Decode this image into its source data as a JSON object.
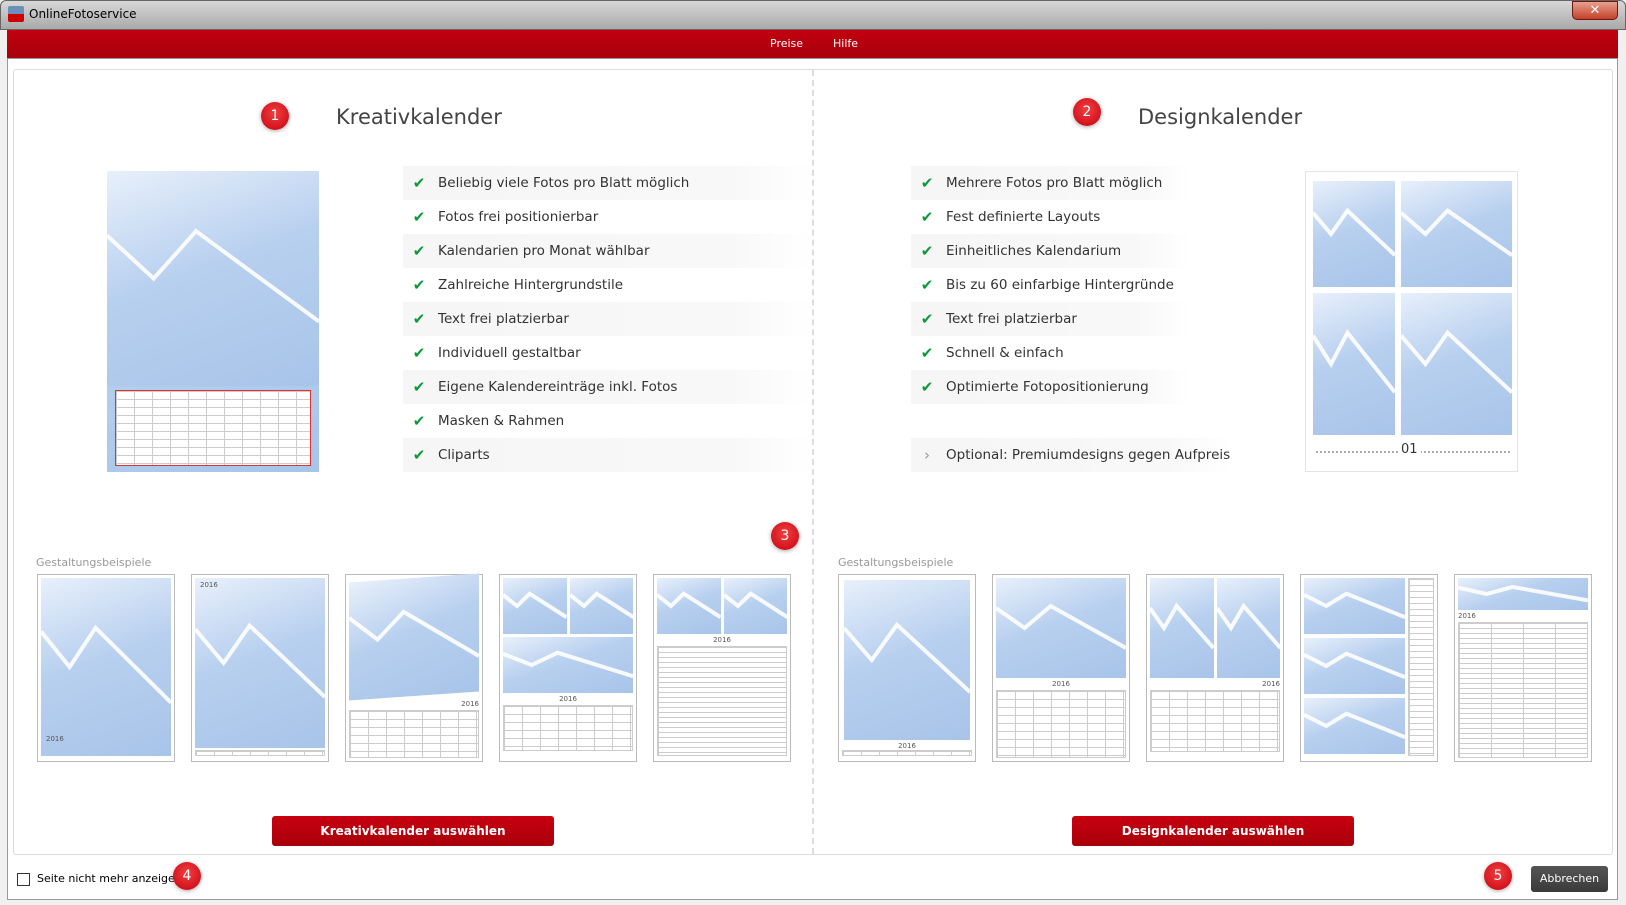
{
  "window": {
    "title": "OnlineFotoservice",
    "close": "✕"
  },
  "menu": [
    {
      "label": "Preise"
    },
    {
      "label": "Hilfe"
    }
  ],
  "badges": [
    "1",
    "2",
    "3",
    "4",
    "5"
  ],
  "kreativ": {
    "title": "Kreativkalender",
    "features": [
      "Beliebig viele Fotos pro Blatt möglich",
      "Fotos frei positionierbar",
      "Kalendarien pro Monat wählbar",
      "Zahlreiche Hintergrundstile",
      "Text frei platzierbar",
      "Individuell gestaltbar",
      "Eigene Kalendereinträge inkl. Fotos",
      "Masken & Rahmen",
      "Cliparts"
    ],
    "examples_label": "Gestaltungsbeispiele",
    "select_button": "Kreativkalender auswählen"
  },
  "design": {
    "title": "Designkalender",
    "features": [
      "Mehrere Fotos pro Blatt möglich",
      "Fest definierte Layouts",
      "Einheitliches Kalendarium",
      "Bis zu 60 einfarbige Hintergründe",
      "Text frei platzierbar",
      "Schnell & einfach",
      "Optimierte Fotopositionierung"
    ],
    "optional": "Optional: Premiumdesigns gegen Aufpreis",
    "month_number": "01",
    "examples_label": "Gestaltungsbeispiele",
    "select_button": "Designkalender auswählen"
  },
  "year": "2016",
  "footer": {
    "checkbox_label": "Seite nicht mehr anzeigen",
    "checkbox_checked": false,
    "cancel_button": "Abbrechen"
  },
  "colors": {
    "brand": "#b8000e",
    "check": "#0a9a3a"
  }
}
